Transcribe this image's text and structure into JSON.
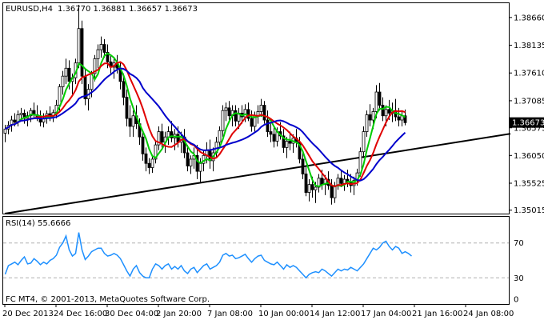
{
  "header": {
    "symbol_timeframe": "EURUSD,H4",
    "ohlc": "1.36770 1.36881 1.36657 1.36673"
  },
  "rsi_header": {
    "label": "RSI(14) 55.6666"
  },
  "footer": {
    "copyright": "FC MT4, © 2001-2013, MetaQuotes Software Corp."
  },
  "chart_data": [
    {
      "type": "candlestick",
      "title": "EURUSD,H4",
      "price_axis": {
        "ticks": [
          "1.38660",
          "1.38135",
          "1.37610",
          "1.37085",
          "1.36573",
          "1.36050",
          "1.35525",
          "1.35015"
        ],
        "tick_values": [
          1.3866,
          1.38135,
          1.3761,
          1.37085,
          1.36573,
          1.3605,
          1.35525,
          1.35015
        ],
        "ylim": [
          1.3495,
          1.3893
        ]
      },
      "current_price": {
        "label": "1.36673",
        "value": 1.36673,
        "bg": "#000000",
        "fg": "#ffffff"
      },
      "time_axis": {
        "labels": [
          "20 Dec 2013",
          "24 Dec 16:00",
          "30 Dec 04:00",
          "2 Jan 20:00",
          "7 Jan 08:00",
          "10 Jan 00:00",
          "14 Jan 12:00",
          "17 Jan 04:00",
          "21 Jan 16:00",
          "24 Jan 08:00"
        ],
        "label_bar_index": [
          0,
          16,
          32,
          48,
          64,
          80,
          96,
          112,
          128,
          144
        ]
      },
      "candles_ohlc": [
        [
          1.3647,
          1.3663,
          1.363,
          1.3655
        ],
        [
          1.3655,
          1.367,
          1.3645,
          1.3662
        ],
        [
          1.3662,
          1.368,
          1.365,
          1.3672
        ],
        [
          1.3672,
          1.3685,
          1.366,
          1.3668
        ],
        [
          1.3668,
          1.369,
          1.366,
          1.3682
        ],
        [
          1.3682,
          1.3695,
          1.367,
          1.3685
        ],
        [
          1.3685,
          1.3692,
          1.3665,
          1.3675
        ],
        [
          1.3675,
          1.3688,
          1.366,
          1.368
        ],
        [
          1.368,
          1.3695,
          1.3668,
          1.369
        ],
        [
          1.369,
          1.3705,
          1.3675,
          1.3682
        ],
        [
          1.3682,
          1.37,
          1.367,
          1.3678
        ],
        [
          1.3678,
          1.369,
          1.366,
          1.3668
        ],
        [
          1.3668,
          1.3685,
          1.3658,
          1.3675
        ],
        [
          1.3675,
          1.369,
          1.3665,
          1.3684
        ],
        [
          1.3684,
          1.3698,
          1.367,
          1.368
        ],
        [
          1.368,
          1.3692,
          1.3668,
          1.3686
        ],
        [
          1.3686,
          1.371,
          1.3675,
          1.37
        ],
        [
          1.37,
          1.374,
          1.369,
          1.3735
        ],
        [
          1.3735,
          1.3765,
          1.372,
          1.3755
        ],
        [
          1.3755,
          1.3788,
          1.374,
          1.377
        ],
        [
          1.377,
          1.3785,
          1.373,
          1.3745
        ],
        [
          1.3745,
          1.376,
          1.372,
          1.3752
        ],
        [
          1.3752,
          1.3788,
          1.374,
          1.378
        ],
        [
          1.378,
          1.389,
          1.377,
          1.3845
        ],
        [
          1.3845,
          1.386,
          1.374,
          1.3755
        ],
        [
          1.3755,
          1.377,
          1.37,
          1.3712
        ],
        [
          1.3712,
          1.374,
          1.369,
          1.373
        ],
        [
          1.373,
          1.3765,
          1.3715,
          1.376
        ],
        [
          1.376,
          1.3795,
          1.3745,
          1.3788
        ],
        [
          1.3788,
          1.3815,
          1.377,
          1.3805
        ],
        [
          1.3805,
          1.383,
          1.379,
          1.3815
        ],
        [
          1.3815,
          1.3825,
          1.379,
          1.38
        ],
        [
          1.38,
          1.3815,
          1.377,
          1.3782
        ],
        [
          1.3782,
          1.3795,
          1.376,
          1.3772
        ],
        [
          1.3772,
          1.379,
          1.375,
          1.378
        ],
        [
          1.378,
          1.3795,
          1.376,
          1.377
        ],
        [
          1.377,
          1.378,
          1.373,
          1.3745
        ],
        [
          1.3745,
          1.376,
          1.37,
          1.3715
        ],
        [
          1.3715,
          1.373,
          1.366,
          1.3675
        ],
        [
          1.3675,
          1.37,
          1.364,
          1.366
        ],
        [
          1.366,
          1.369,
          1.364,
          1.368
        ],
        [
          1.368,
          1.37,
          1.3655,
          1.3665
        ],
        [
          1.3665,
          1.3675,
          1.3625,
          1.364
        ],
        [
          1.364,
          1.365,
          1.3595,
          1.3608
        ],
        [
          1.3608,
          1.362,
          1.3575,
          1.359
        ],
        [
          1.359,
          1.36,
          1.357,
          1.3582
        ],
        [
          1.3582,
          1.3605,
          1.3572,
          1.3598
        ],
        [
          1.3598,
          1.3632,
          1.359,
          1.3625
        ],
        [
          1.3625,
          1.366,
          1.3615,
          1.365
        ],
        [
          1.365,
          1.3665,
          1.362,
          1.363
        ],
        [
          1.363,
          1.365,
          1.361,
          1.364
        ],
        [
          1.364,
          1.366,
          1.3625,
          1.365
        ],
        [
          1.365,
          1.367,
          1.363,
          1.3638
        ],
        [
          1.3638,
          1.3655,
          1.3615,
          1.3645
        ],
        [
          1.3645,
          1.366,
          1.362,
          1.363
        ],
        [
          1.363,
          1.365,
          1.361,
          1.364
        ],
        [
          1.364,
          1.3655,
          1.36,
          1.361
        ],
        [
          1.361,
          1.3625,
          1.3575,
          1.3585
        ],
        [
          1.3585,
          1.3605,
          1.357,
          1.3598
        ],
        [
          1.3598,
          1.362,
          1.358,
          1.3605
        ],
        [
          1.3605,
          1.3625,
          1.356,
          1.3575
        ],
        [
          1.3575,
          1.36,
          1.3555,
          1.359
        ],
        [
          1.359,
          1.3615,
          1.3575,
          1.3605
        ],
        [
          1.3605,
          1.363,
          1.359,
          1.3615
        ],
        [
          1.3615,
          1.3635,
          1.358,
          1.3595
        ],
        [
          1.3595,
          1.362,
          1.3575,
          1.361
        ],
        [
          1.361,
          1.364,
          1.36,
          1.363
        ],
        [
          1.363,
          1.366,
          1.362,
          1.3652
        ],
        [
          1.3652,
          1.37,
          1.364,
          1.369
        ],
        [
          1.369,
          1.3705,
          1.367,
          1.3695
        ],
        [
          1.3695,
          1.3708,
          1.3672,
          1.368
        ],
        [
          1.368,
          1.37,
          1.366,
          1.369
        ],
        [
          1.369,
          1.37,
          1.366,
          1.367
        ],
        [
          1.367,
          1.3695,
          1.3655,
          1.3685
        ],
        [
          1.3685,
          1.37,
          1.3665,
          1.3678
        ],
        [
          1.3678,
          1.3702,
          1.3668,
          1.3692
        ],
        [
          1.3692,
          1.3705,
          1.367,
          1.3675
        ],
        [
          1.3675,
          1.369,
          1.365,
          1.366
        ],
        [
          1.366,
          1.3688,
          1.365,
          1.368
        ],
        [
          1.368,
          1.37,
          1.3665,
          1.3688
        ],
        [
          1.3688,
          1.3712,
          1.3678,
          1.37
        ],
        [
          1.37,
          1.3708,
          1.3665,
          1.3672
        ],
        [
          1.3672,
          1.369,
          1.364,
          1.365
        ],
        [
          1.365,
          1.3665,
          1.363,
          1.3645
        ],
        [
          1.3645,
          1.366,
          1.362,
          1.3632
        ],
        [
          1.3632,
          1.3658,
          1.3622,
          1.365
        ],
        [
          1.365,
          1.3668,
          1.3635,
          1.3642
        ],
        [
          1.3642,
          1.3655,
          1.361,
          1.362
        ],
        [
          1.362,
          1.364,
          1.36,
          1.3632
        ],
        [
          1.3632,
          1.365,
          1.3615,
          1.3628
        ],
        [
          1.3628,
          1.3645,
          1.361,
          1.3638
        ],
        [
          1.3638,
          1.3655,
          1.362,
          1.363
        ],
        [
          1.363,
          1.364,
          1.359,
          1.3598
        ],
        [
          1.3598,
          1.3612,
          1.356,
          1.357
        ],
        [
          1.357,
          1.3585,
          1.3528,
          1.3535
        ],
        [
          1.3535,
          1.356,
          1.3518,
          1.355
        ],
        [
          1.355,
          1.3565,
          1.3525,
          1.354
        ],
        [
          1.354,
          1.3555,
          1.3515,
          1.3545
        ],
        [
          1.3545,
          1.357,
          1.3535,
          1.3562
        ],
        [
          1.3562,
          1.3578,
          1.354,
          1.355
        ],
        [
          1.355,
          1.3568,
          1.353,
          1.356
        ],
        [
          1.356,
          1.3575,
          1.354,
          1.3548
        ],
        [
          1.3548,
          1.356,
          1.3512,
          1.3525
        ],
        [
          1.3525,
          1.3555,
          1.3515,
          1.3548
        ],
        [
          1.3548,
          1.357,
          1.354,
          1.3562
        ],
        [
          1.3562,
          1.3575,
          1.3545,
          1.3552
        ],
        [
          1.3552,
          1.3568,
          1.3538,
          1.356
        ],
        [
          1.356,
          1.3578,
          1.3545,
          1.3555
        ],
        [
          1.3555,
          1.357,
          1.3535,
          1.3548
        ],
        [
          1.3548,
          1.3565,
          1.353,
          1.3558
        ],
        [
          1.3558,
          1.358,
          1.3548,
          1.3572
        ],
        [
          1.3572,
          1.362,
          1.3565,
          1.3612
        ],
        [
          1.3612,
          1.366,
          1.36,
          1.365
        ],
        [
          1.365,
          1.369,
          1.364,
          1.3682
        ],
        [
          1.3682,
          1.3702,
          1.366,
          1.3672
        ],
        [
          1.3672,
          1.3695,
          1.3655,
          1.3688
        ],
        [
          1.3688,
          1.3738,
          1.3675,
          1.3725
        ],
        [
          1.3725,
          1.3742,
          1.369,
          1.37
        ],
        [
          1.37,
          1.3715,
          1.367,
          1.368
        ],
        [
          1.368,
          1.37,
          1.366,
          1.3692
        ],
        [
          1.3692,
          1.371,
          1.3672,
          1.3685
        ],
        [
          1.3685,
          1.3705,
          1.3668,
          1.369
        ],
        [
          1.369,
          1.3712,
          1.367,
          1.3678
        ],
        [
          1.3678,
          1.3695,
          1.366,
          1.3672
        ],
        [
          1.3672,
          1.369,
          1.366,
          1.368
        ],
        [
          1.368,
          1.3692,
          1.3662,
          1.3667
        ]
      ],
      "moving_averages": [
        {
          "period": 5,
          "color": "#00cc00"
        },
        {
          "period": 10,
          "color": "#e00000"
        },
        {
          "period": 20,
          "color": "#0000cc"
        }
      ],
      "trendline": {
        "color": "#000000",
        "from": {
          "bar": 0,
          "price": 1.3495
        },
        "to": {
          "bar": 158,
          "price": 1.3646
        }
      }
    },
    {
      "type": "line",
      "title": "RSI(14) 55.6666",
      "ylim": [
        0,
        100
      ],
      "ticks": [
        "70",
        "30",
        "0"
      ],
      "tick_values": [
        70,
        30,
        0
      ],
      "levels": [
        70,
        30
      ],
      "series": [
        {
          "color": "#1e90ff",
          "values": [
            34,
            44,
            46,
            48,
            45,
            50,
            54,
            46,
            47,
            52,
            49,
            45,
            48,
            46,
            50,
            52,
            56,
            65,
            70,
            78,
            62,
            55,
            58,
            82,
            62,
            51,
            55,
            60,
            62,
            64,
            64,
            58,
            55,
            56,
            58,
            56,
            52,
            45,
            38,
            32,
            40,
            44,
            36,
            32,
            30,
            30,
            40,
            46,
            44,
            40,
            44,
            46,
            40,
            43,
            40,
            44,
            38,
            35,
            40,
            42,
            36,
            40,
            44,
            46,
            40,
            42,
            44,
            48,
            56,
            58,
            55,
            56,
            52,
            53,
            55,
            57,
            52,
            48,
            52,
            55,
            56,
            50,
            48,
            46,
            45,
            48,
            44,
            40,
            45,
            42,
            44,
            42,
            38,
            34,
            30,
            34,
            36,
            37,
            36,
            40,
            38,
            35,
            32,
            36,
            40,
            38,
            40,
            39,
            42,
            40,
            38,
            42,
            46,
            52,
            58,
            64,
            62,
            65,
            70,
            72,
            66,
            62,
            66,
            64,
            58,
            60,
            58,
            55
          ]
        }
      ]
    }
  ]
}
